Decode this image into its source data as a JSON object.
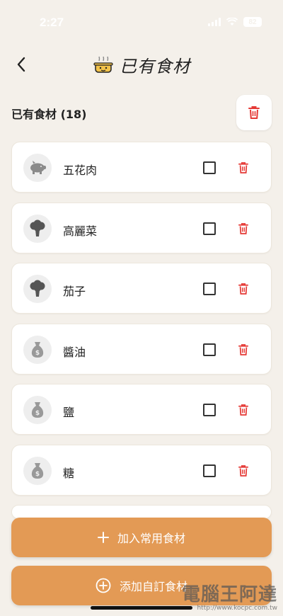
{
  "status": {
    "time": "2:27",
    "battery": "82"
  },
  "nav": {
    "title": "已有食材"
  },
  "section": {
    "title": "已有食材 (18)"
  },
  "items": [
    {
      "name": "五花肉",
      "icon": "pig-icon"
    },
    {
      "name": "高麗菜",
      "icon": "broccoli-icon"
    },
    {
      "name": "茄子",
      "icon": "broccoli-icon"
    },
    {
      "name": "醬油",
      "icon": "sack-icon"
    },
    {
      "name": "鹽",
      "icon": "sack-icon"
    },
    {
      "name": "糖",
      "icon": "sack-icon"
    }
  ],
  "buttons": {
    "add_common": "加入常用食材",
    "add_custom": "添加自訂食材"
  },
  "watermark": {
    "title": "電腦王阿達",
    "url": "http://www.kocpc.com.tw"
  },
  "colors": {
    "accent": "#e39a55",
    "delete": "#e53935",
    "background": "#f4f0ea"
  }
}
